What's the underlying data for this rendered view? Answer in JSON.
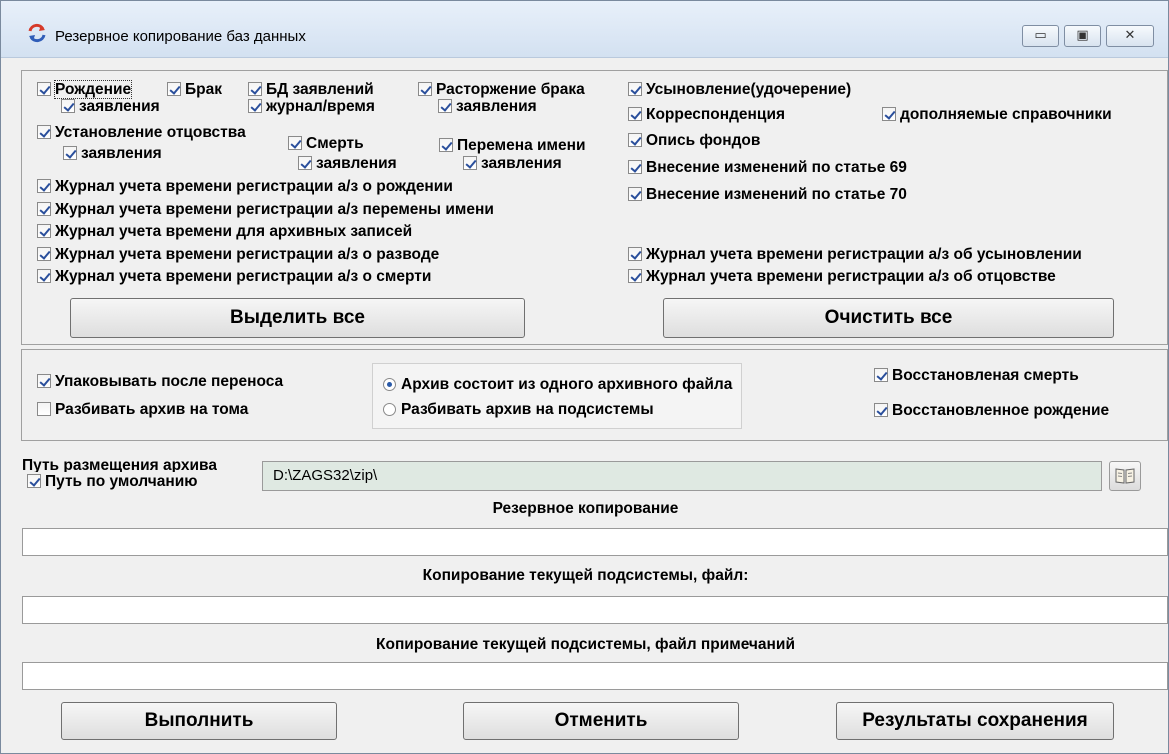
{
  "window": {
    "title": "Резервное копирование баз данных",
    "controls": {
      "minimize": "▭",
      "maximize": "▣",
      "close": "✕"
    }
  },
  "checks": {
    "rozhdenie": {
      "label": "Рождение",
      "checked": true
    },
    "rozhdenie_zayav": {
      "label": "заявления",
      "checked": true
    },
    "brak": {
      "label": "Брак",
      "checked": true
    },
    "bd_zayav": {
      "label": "БД заявлений",
      "checked": true
    },
    "zhurnal_vremya": {
      "label": "журнал/время",
      "checked": true
    },
    "rastorzhenie": {
      "label": "Расторжение брака",
      "checked": true
    },
    "rastorzhenie_zayav": {
      "label": "заявления",
      "checked": true
    },
    "usynovlenie": {
      "label": "Усыновление(удочерение)",
      "checked": true
    },
    "korrespondencia": {
      "label": "Корреспонденция",
      "checked": true
    },
    "dopolnyaemye": {
      "label": "дополняемые справочники",
      "checked": true
    },
    "ustanovlenie": {
      "label": "Установление отцовства",
      "checked": true
    },
    "ustanovlenie_zayav": {
      "label": "заявления",
      "checked": true
    },
    "smert": {
      "label": "Смерть",
      "checked": true
    },
    "smert_zayav": {
      "label": "заявления",
      "checked": true
    },
    "peremena": {
      "label": "Перемена имени",
      "checked": true
    },
    "peremena_zayav": {
      "label": "заявления",
      "checked": true
    },
    "opis": {
      "label": "Опись фондов",
      "checked": true
    },
    "vnesenie69": {
      "label": "Внесение изменений по статье 69",
      "checked": true
    },
    "vnesenie70": {
      "label": "Внесение изменений по статье 70",
      "checked": true
    },
    "j_rozhdenie": {
      "label": "Журнал учета времени регистрации а/з о рождении",
      "checked": true
    },
    "j_peremena": {
      "label": "Журнал учета времени регистрации а/з перемены имени",
      "checked": true
    },
    "j_arhiv": {
      "label": "Журнал учета времени для архивных записей",
      "checked": true
    },
    "j_razvod": {
      "label": "Журнал учета времени регистрации а/з о разводе",
      "checked": true
    },
    "j_smert": {
      "label": "Журнал учета времени регистрации а/з о смерти",
      "checked": true
    },
    "j_usynovlenie": {
      "label": "Журнал учета времени регистрации а/з об усыновлении",
      "checked": true
    },
    "j_otcovstvo": {
      "label": "Журнал учета времени регистрации а/з об отцовстве",
      "checked": true
    },
    "upakovyvat": {
      "label": "Упаковывать после переноса",
      "checked": true
    },
    "razbivat_toma": {
      "label": "Разбивать архив на тома",
      "checked": false
    },
    "vosst_smert": {
      "label": "Восстановленая смерть",
      "checked": true
    },
    "vosst_rozhdenie": {
      "label": "Восстановленное рождение",
      "checked": true
    },
    "put_default": {
      "label": "Путь по умолчанию",
      "checked": true
    }
  },
  "radios": {
    "one_file": {
      "label": "Архив состоит из одного архивного файла",
      "selected": true
    },
    "subsystems": {
      "label": "Разбивать архив на подсистемы",
      "selected": false
    }
  },
  "buttons": {
    "select_all": "Выделить все",
    "clear_all": "Очистить все",
    "run": "Выполнить",
    "cancel": "Отменить",
    "results": "Результаты сохранения"
  },
  "path": {
    "label": "Путь размещения архива",
    "value": "D:\\ZAGS32\\zip\\"
  },
  "progress": {
    "backup_label": "Резервное копирование",
    "backup_fraction": 0,
    "file_label": "Копирование текущей подсистемы, файл:",
    "file_fraction": 0,
    "notes_label": "Копирование текущей подсистемы, файл примечаний",
    "notes_fraction": 0
  },
  "colors": {
    "titlebar": "#d9e6f4",
    "path_field_bg": "#dfe9e2",
    "check_mark": "#2a4f9c"
  }
}
